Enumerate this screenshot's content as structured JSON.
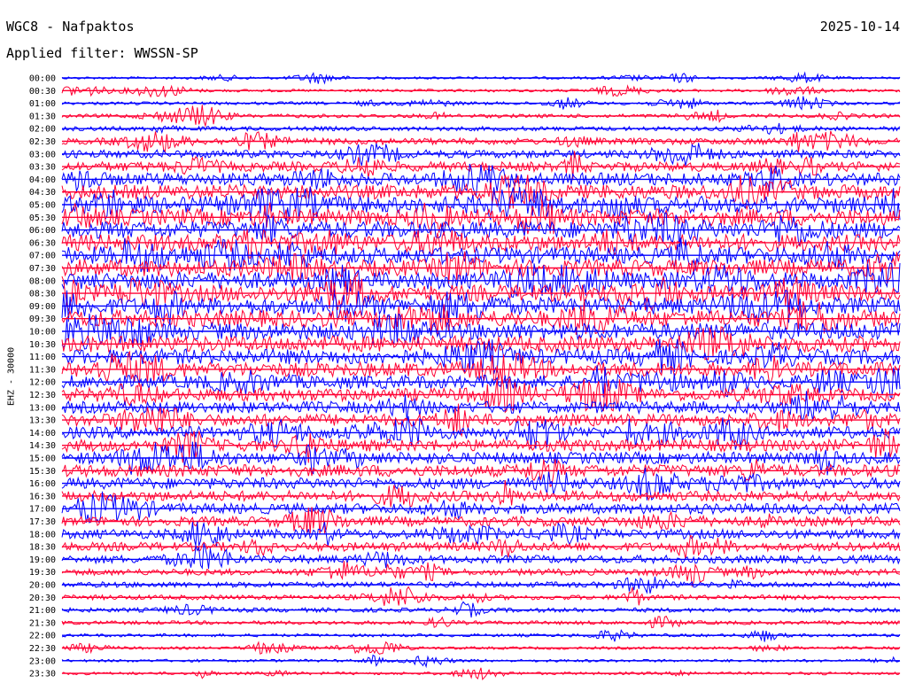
{
  "header": {
    "station": "WGC8 - Nafpaktos",
    "date": "2025-10-14",
    "filter": "Applied filter: WWSSN-SP"
  },
  "chart_data": {
    "type": "line",
    "subtype": "helicorder",
    "ylabel": "EHZ - 30000",
    "row_labels": [
      "00:00",
      "00:30",
      "01:00",
      "01:30",
      "02:00",
      "02:30",
      "03:00",
      "03:30",
      "04:00",
      "04:30",
      "05:00",
      "05:30",
      "06:00",
      "06:30",
      "07:00",
      "07:30",
      "08:00",
      "08:30",
      "09:00",
      "09:30",
      "10:00",
      "10:30",
      "11:00",
      "11:30",
      "12:00",
      "12:30",
      "13:00",
      "13:30",
      "14:00",
      "14:30",
      "15:00",
      "15:30",
      "16:00",
      "16:30",
      "17:00",
      "17:30",
      "18:00",
      "18:30",
      "19:00",
      "19:30",
      "20:00",
      "20:30",
      "21:00",
      "21:30",
      "22:00",
      "22:30",
      "23:00",
      "23:30"
    ],
    "trace_colors": [
      "#0000ff",
      "#ff0033"
    ],
    "activity": [
      0.1,
      0.12,
      0.14,
      0.18,
      0.22,
      0.35,
      0.45,
      0.55,
      0.75,
      0.85,
      1.0,
      1.0,
      1.0,
      1.0,
      1.0,
      1.0,
      1.0,
      1.0,
      1.0,
      1.0,
      1.0,
      0.95,
      0.9,
      0.85,
      0.8,
      0.75,
      0.7,
      0.7,
      0.7,
      0.7,
      0.7,
      0.7,
      0.65,
      0.6,
      0.6,
      0.55,
      0.55,
      0.5,
      0.45,
      0.35,
      0.3,
      0.25,
      0.22,
      0.18,
      0.14,
      0.12,
      0.12,
      0.12
    ]
  }
}
